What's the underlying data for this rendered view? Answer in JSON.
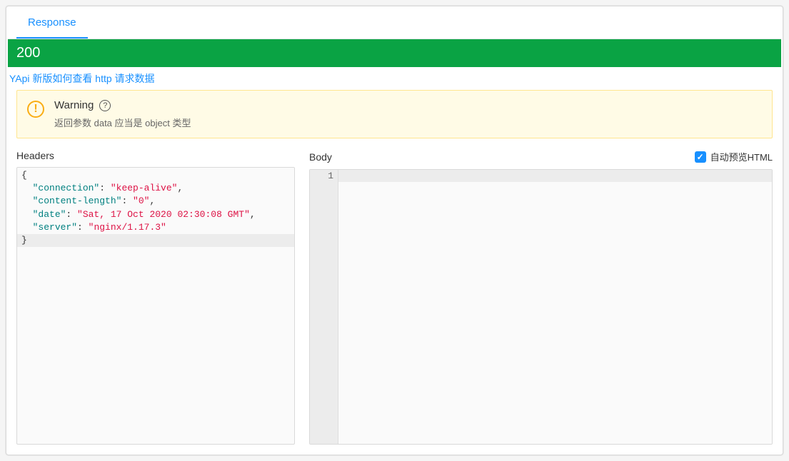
{
  "tabs": {
    "response_label": "Response"
  },
  "status": {
    "code": "200",
    "bg": "#0aa344"
  },
  "link": {
    "text": "YApi 新版如何查看 http 请求数据"
  },
  "warning": {
    "title": "Warning",
    "desc": "返回参数 data 应当是 object 类型"
  },
  "headers": {
    "title": "Headers",
    "json": {
      "connection": "keep-alive",
      "content-length": "0",
      "date": "Sat, 17 Oct 2020 02:30:08 GMT",
      "server": "nginx/1.17.3"
    }
  },
  "body": {
    "title": "Body",
    "preview_label": "自动预览HTML",
    "preview_checked": true,
    "line_numbers": [
      "1"
    ],
    "content": ""
  }
}
